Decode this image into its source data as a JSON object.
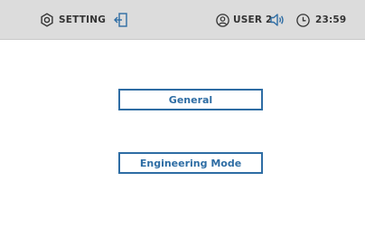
{
  "topbar": {
    "setting_label": "SETTING",
    "user_label": "USER 2",
    "time": "23:59",
    "icons": {
      "setting": "gear-icon",
      "exit": "exit-icon",
      "user": "user-icon",
      "sound": "speaker-icon",
      "clock": "clock-icon"
    },
    "accent_color": "#2e6da4"
  },
  "menu": {
    "items": [
      {
        "label": "General"
      },
      {
        "label": "Engineering Mode"
      }
    ]
  }
}
